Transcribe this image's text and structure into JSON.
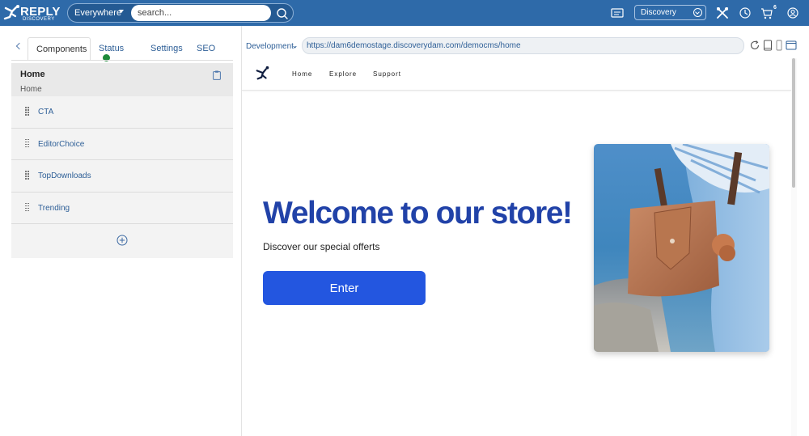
{
  "topbar": {
    "logo_text": "REPLY",
    "logo_sub": "DISCOVERY",
    "search_scope": "Everywhere",
    "search_placeholder": "search...",
    "catalog_selected": "Discovery",
    "cart_count": "6",
    "icons": [
      "search-icon",
      "catalog-icon",
      "tools-icon",
      "history-icon",
      "cart-icon",
      "user-icon"
    ]
  },
  "left_panel": {
    "tabs": [
      {
        "label": "Components"
      },
      {
        "label": "Status"
      },
      {
        "label": "Settings"
      },
      {
        "label": "SEO"
      }
    ],
    "status_color": "#1d8a3a",
    "page": {
      "title": "Home",
      "subtitle": "Home"
    },
    "components": [
      {
        "label": "CTA"
      },
      {
        "label": "EditorChoice"
      },
      {
        "label": "TopDownloads"
      },
      {
        "label": "Trending"
      }
    ]
  },
  "preview_bar": {
    "environment": "Development",
    "url": "https://dam6demostage.discoverydam.com/democms/home"
  },
  "site": {
    "nav": [
      {
        "label": "Home"
      },
      {
        "label": "Explore"
      },
      {
        "label": "Support"
      }
    ],
    "hero_title": "Welcome to our store!",
    "hero_subtitle": "Discover our special offerts",
    "hero_button": "Enter",
    "accent_color": "#2356e0",
    "title_color": "#2142a8"
  },
  "colors": {
    "topbar": "#2e6aa9",
    "link": "#2e5f97"
  }
}
